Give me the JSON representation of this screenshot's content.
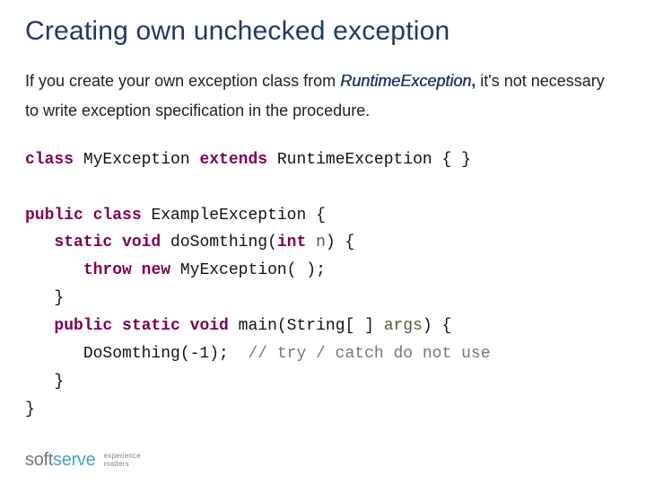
{
  "title": "Creating own unchecked exception",
  "intro": {
    "before": "If you create your own exception class from ",
    "runtime": "RuntimeException",
    "comma": ",",
    "after": " it's not necessary to write exception specification in the procedure."
  },
  "code": {
    "l1": {
      "kw1": "class",
      "t1": " MyException ",
      "kw2": "extends",
      "t2": " RuntimeException { }"
    },
    "l2": {
      "kw1": "public",
      "sp1": " ",
      "kw2": "class",
      "t1": " ExampleException {"
    },
    "l3": {
      "pad": "   ",
      "kw1": "static",
      "sp1": " ",
      "kw2": "void",
      "t1": " doSomthing(",
      "kw3": "int",
      "sp2": " ",
      "arg": "n",
      "t2": ") {"
    },
    "l4": {
      "pad": "      ",
      "kw1": "throw",
      "sp1": " ",
      "kw2": "new",
      "t1": " MyException( );"
    },
    "l5": {
      "pad": "   ",
      "t1": "}"
    },
    "l6": {
      "pad": "   ",
      "kw1": "public",
      "sp1": " ",
      "kw2": "static",
      "sp2": " ",
      "kw3": "void",
      "t1": " main(String[ ] ",
      "arg": "args",
      "t2": ") {"
    },
    "l7": {
      "pad": "      ",
      "t1": "DoSomthing(-1);  ",
      "cmt": "// try / catch do not use"
    },
    "l8": {
      "pad": "   ",
      "t1": "}"
    },
    "l9": {
      "t1": "}"
    }
  },
  "logo": {
    "a": "soft",
    "b": "serve",
    "tag1": "experience",
    "tag2": "matters"
  }
}
